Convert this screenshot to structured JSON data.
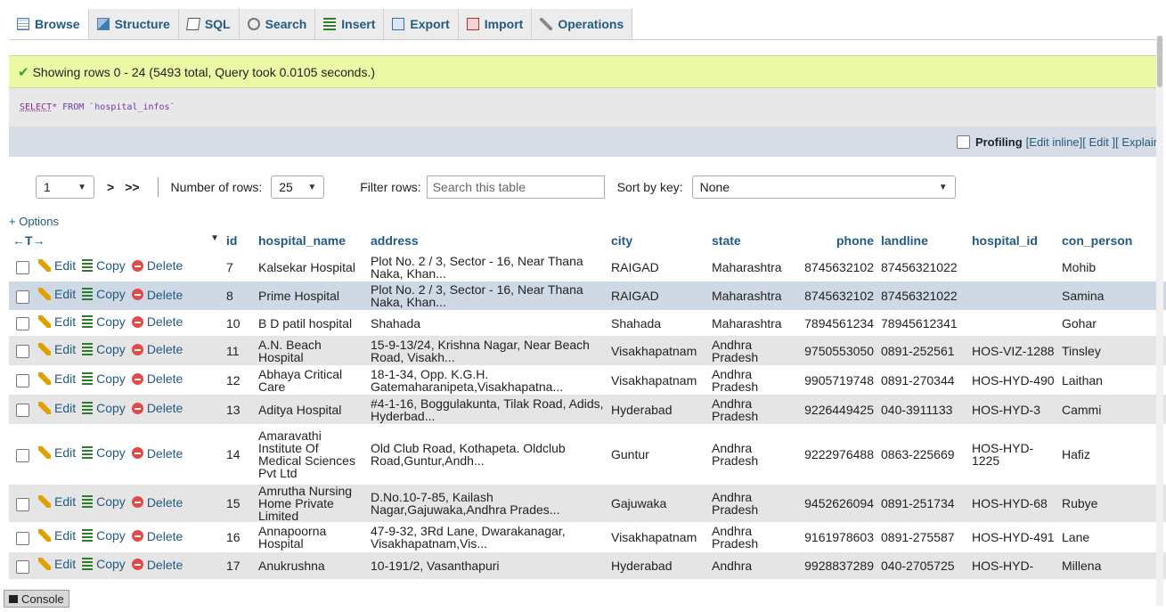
{
  "tabs": [
    {
      "label": "Browse",
      "icon": "browse-icon"
    },
    {
      "label": "Structure",
      "icon": "structure-icon"
    },
    {
      "label": "SQL",
      "icon": "sql-icon"
    },
    {
      "label": "Search",
      "icon": "search-icon"
    },
    {
      "label": "Insert",
      "icon": "insert-icon"
    },
    {
      "label": "Export",
      "icon": "export-icon"
    },
    {
      "label": "Import",
      "icon": "import-icon"
    },
    {
      "label": "Operations",
      "icon": "operations-icon"
    }
  ],
  "message": "Showing rows 0 - 24 (5493 total, Query took 0.0105 seconds.)",
  "sql": {
    "keyword": "SELECT",
    "rest": " * FROM `hospital_infos`"
  },
  "profiling": {
    "label": "Profiling",
    "links": [
      "[Edit inline]",
      "[ Edit ]",
      "[ Explain"
    ]
  },
  "nav": {
    "page": "1",
    "next": ">",
    "last": ">>",
    "rows_label": "Number of rows:",
    "rows_value": "25",
    "filter_label": "Filter rows:",
    "filter_placeholder": "Search this table",
    "sort_label": "Sort by key:",
    "sort_value": "None"
  },
  "options_label": "+ Options",
  "arrows": "←T→",
  "columns": [
    "id",
    "hospital_name",
    "address",
    "city",
    "state",
    "phone",
    "landline",
    "hospital_id",
    "con_person"
  ],
  "actions": {
    "edit": "Edit",
    "copy": "Copy",
    "delete": "Delete"
  },
  "rows": [
    {
      "id": "7",
      "hospital_name": "Kalsekar Hospital",
      "address": "Plot No. 2 / 3, Sector - 16, Near Thana Naka, Khan...",
      "city": "RAIGAD",
      "state": "Maharashtra",
      "phone": "8745632102",
      "landline": "87456321022",
      "hospital_id": "",
      "con_person": "Mohib"
    },
    {
      "id": "8",
      "hospital_name": "Prime Hospital",
      "address": "Plot No. 2 / 3, Sector - 16, Near Thana Naka, Khan...",
      "city": "RAIGAD",
      "state": "Maharashtra",
      "phone": "8745632102",
      "landline": "87456321022",
      "hospital_id": "",
      "con_person": "Samina"
    },
    {
      "id": "10",
      "hospital_name": "B D patil hospital",
      "address": "Shahada",
      "city": "Shahada",
      "state": "Maharashtra",
      "phone": "7894561234",
      "landline": "78945612341",
      "hospital_id": "",
      "con_person": "Gohar"
    },
    {
      "id": "11",
      "hospital_name": "A.N. Beach Hospital",
      "address": "15-9-13/24, Krishna Nagar, Near Beach Road, Visakh...",
      "city": "Visakhapatnam",
      "state": "Andhra Pradesh",
      "phone": "9750553050",
      "landline": "0891-252561",
      "hospital_id": "HOS-VIZ-1288",
      "con_person": "Tinsley"
    },
    {
      "id": "12",
      "hospital_name": "Abhaya Critical Care",
      "address": "18-1-34, Opp. K.G.H. Gatemaharanipeta,Visakhapatna...",
      "city": "Visakhapatnam",
      "state": "Andhra Pradesh",
      "phone": "9905719748",
      "landline": "0891-270344",
      "hospital_id": "HOS-HYD-490",
      "con_person": "Laithan"
    },
    {
      "id": "13",
      "hospital_name": "Aditya Hospital",
      "address": "#4-1-16, Boggulakunta, Tilak Road, Adids, Hyderbad...",
      "city": "Hyderabad",
      "state": "Andhra Pradesh",
      "phone": "9226449425",
      "landline": "040-3911133",
      "hospital_id": "HOS-HYD-3",
      "con_person": "Cammi"
    },
    {
      "id": "14",
      "hospital_name": "Amaravathi Institute Of Medical Sciences Pvt Ltd",
      "address": "Old Club Road, Kothapeta. Oldclub Road,Guntur,Andh...",
      "city": "Guntur",
      "state": "Andhra Pradesh",
      "phone": "9222976488",
      "landline": "0863-225669",
      "hospital_id": "HOS-HYD-1225",
      "con_person": "Hafiz"
    },
    {
      "id": "15",
      "hospital_name": "Amrutha Nursing Home Private Limited",
      "address": "D.No.10-7-85, Kailash Nagar,Gajuwaka,Andhra Prades...",
      "city": "Gajuwaka",
      "state": "Andhra Pradesh",
      "phone": "9452626094",
      "landline": "0891-251734",
      "hospital_id": "HOS-HYD-68",
      "con_person": "Rubye"
    },
    {
      "id": "16",
      "hospital_name": "Annapoorna Hospital",
      "address": "47-9-32, 3Rd Lane, Dwarakanagar, Visakhapatnam,Vis...",
      "city": "Visakhapatnam",
      "state": "Andhra Pradesh",
      "phone": "9161978603",
      "landline": "0891-275587",
      "hospital_id": "HOS-HYD-491",
      "con_person": "Lane"
    },
    {
      "id": "17",
      "hospital_name": "Anukrushna",
      "address": "10-191/2, Vasanthapuri",
      "city": "Hyderabad",
      "state": "Andhra",
      "phone": "9928837289",
      "landline": "040-2705725",
      "hospital_id": "HOS-HYD-",
      "con_person": "Millena"
    }
  ],
  "console_label": "Console"
}
